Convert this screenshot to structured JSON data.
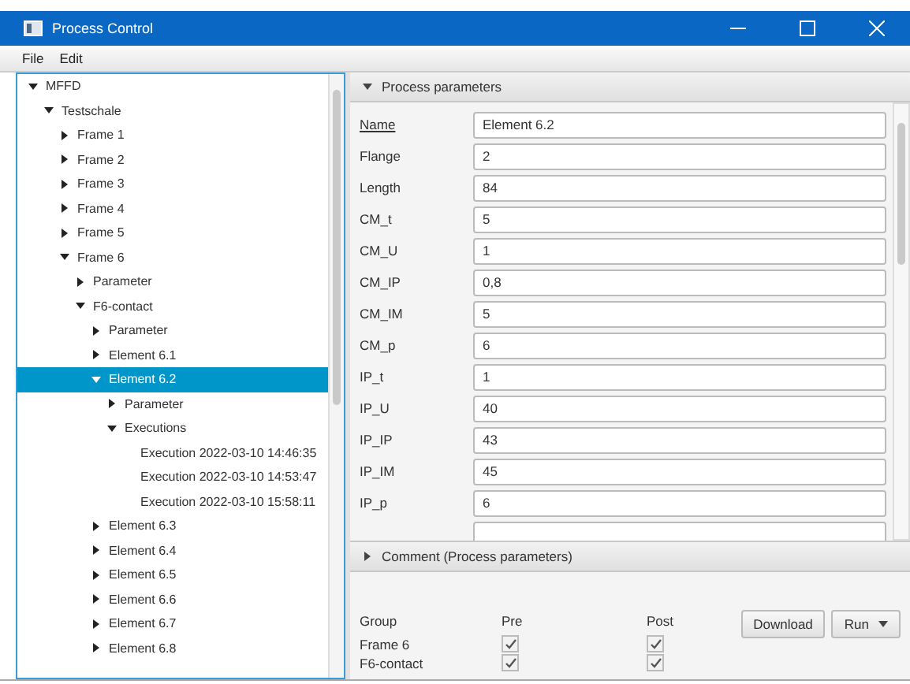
{
  "window": {
    "title": "Process Control"
  },
  "menu": [
    "File",
    "Edit"
  ],
  "tree": [
    {
      "label": "MFFD",
      "expanded": true,
      "selected": false,
      "children": [
        {
          "label": "Testschale",
          "expanded": true,
          "selected": false,
          "children": [
            {
              "label": "Frame 1",
              "expanded": false,
              "selected": false
            },
            {
              "label": "Frame 2",
              "expanded": false,
              "selected": false
            },
            {
              "label": "Frame 3",
              "expanded": false,
              "selected": false
            },
            {
              "label": "Frame 4",
              "expanded": false,
              "selected": false
            },
            {
              "label": "Frame 5",
              "expanded": false,
              "selected": false
            },
            {
              "label": "Frame 6",
              "expanded": true,
              "selected": false,
              "children": [
                {
                  "label": "Parameter",
                  "expanded": false,
                  "selected": false
                },
                {
                  "label": "F6-contact",
                  "expanded": true,
                  "selected": false,
                  "children": [
                    {
                      "label": "Parameter",
                      "expanded": false,
                      "selected": false
                    },
                    {
                      "label": "Element 6.1",
                      "expanded": false,
                      "selected": false
                    },
                    {
                      "label": "Element 6.2",
                      "expanded": true,
                      "selected": true,
                      "children": [
                        {
                          "label": "Parameter",
                          "expanded": false,
                          "selected": false
                        },
                        {
                          "label": "Executions",
                          "expanded": true,
                          "selected": false,
                          "children": [
                            {
                              "label": "Execution 2022-03-10 14:46:35",
                              "selected": false
                            },
                            {
                              "label": "Execution 2022-03-10 14:53:47",
                              "selected": false
                            },
                            {
                              "label": "Execution 2022-03-10 15:58:11",
                              "selected": false
                            }
                          ]
                        }
                      ]
                    },
                    {
                      "label": "Element 6.3",
                      "expanded": false,
                      "selected": false
                    },
                    {
                      "label": "Element 6.4",
                      "expanded": false,
                      "selected": false
                    },
                    {
                      "label": "Element 6.5",
                      "expanded": false,
                      "selected": false
                    },
                    {
                      "label": "Element 6.6",
                      "expanded": false,
                      "selected": false
                    },
                    {
                      "label": "Element 6.7",
                      "expanded": false,
                      "selected": false
                    },
                    {
                      "label": "Element 6.8",
                      "expanded": false,
                      "selected": false
                    }
                  ]
                }
              ]
            }
          ]
        }
      ]
    }
  ],
  "process_parameters": {
    "title": "Process parameters",
    "expanded": true,
    "fields": [
      {
        "label": "Name",
        "value": "Element 6.2",
        "underlined": true
      },
      {
        "label": "Flange",
        "value": "2",
        "underlined": false
      },
      {
        "label": "Length",
        "value": "84",
        "underlined": false
      },
      {
        "label": "CM_t",
        "value": "5",
        "underlined": false
      },
      {
        "label": "CM_U",
        "value": "1",
        "underlined": false
      },
      {
        "label": "CM_IP",
        "value": "0,8",
        "underlined": false
      },
      {
        "label": "CM_IM",
        "value": "5",
        "underlined": false
      },
      {
        "label": "CM_p",
        "value": "6",
        "underlined": false
      },
      {
        "label": "IP_t",
        "value": "1",
        "underlined": false
      },
      {
        "label": "IP_U",
        "value": "40",
        "underlined": false
      },
      {
        "label": "IP_IP",
        "value": "43",
        "underlined": false
      },
      {
        "label": "IP_IM",
        "value": "45",
        "underlined": false
      },
      {
        "label": "IP_p",
        "value": "6",
        "underlined": false
      }
    ]
  },
  "comment_section": {
    "title": "Comment (Process parameters)",
    "expanded": false
  },
  "groups": {
    "columns": [
      "Group",
      "Pre",
      "Post"
    ],
    "rows": [
      {
        "group": "Frame 6",
        "pre": true,
        "post": true
      },
      {
        "group": "F6-contact",
        "pre": true,
        "post": true
      }
    ]
  },
  "buttons": {
    "download": "Download",
    "run": "Run"
  }
}
